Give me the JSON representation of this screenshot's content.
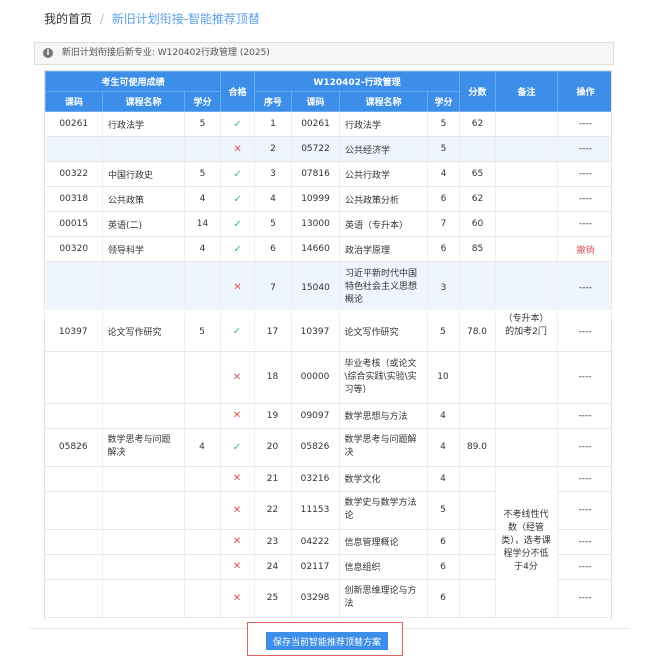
{
  "breadcrumb": {
    "home": "我的首页",
    "separator": "/",
    "current": "新旧计划衔接-智能推荐顶替"
  },
  "notice": {
    "text": "新旧计划衔接后新专业: W120402行政管理 (2025)"
  },
  "headers": {
    "group_left": "考生可使用成绩",
    "group_right": "W120402-行政管理",
    "pass": "合格",
    "score": "分数",
    "remark": "备注",
    "op": "操作",
    "left_code": "课码",
    "left_name": "课程名称",
    "left_credit": "学分",
    "seq": "序号",
    "right_code": "课码",
    "right_name": "课程名称",
    "right_credit": "学分"
  },
  "top_rows": [
    {
      "lcode": "00261",
      "lname": "行政法学",
      "lcredit": "5",
      "pass": "✓",
      "seq": "1",
      "rcode": "00261",
      "rname": "行政法学",
      "rcredit": "5",
      "score": "62",
      "op": "----"
    },
    {
      "lcode": "",
      "lname": "",
      "lcredit": "",
      "pass": "✕",
      "seq": "2",
      "rcode": "05722",
      "rname": "公共经济学",
      "rcredit": "5",
      "score": "",
      "op": "----"
    },
    {
      "lcode": "00322",
      "lname": "中国行政史",
      "lcredit": "5",
      "pass": "✓",
      "seq": "3",
      "rcode": "07816",
      "rname": "公共行政学",
      "rcredit": "4",
      "score": "65",
      "op": "----"
    },
    {
      "lcode": "00318",
      "lname": "公共政策",
      "lcredit": "4",
      "pass": "✓",
      "seq": "4",
      "rcode": "10999",
      "rname": "公共政策分析",
      "rcredit": "6",
      "score": "62",
      "op": "----"
    },
    {
      "lcode": "00015",
      "lname": "英语(二)",
      "lcredit": "14",
      "pass": "✓",
      "seq": "5",
      "rcode": "13000",
      "rname": "英语（专升本）",
      "rcredit": "7",
      "score": "60",
      "op": "----"
    },
    {
      "lcode": "00320",
      "lname": "领导科学",
      "lcredit": "4",
      "pass": "✓",
      "seq": "6",
      "rcode": "14660",
      "rname": "政治学原理",
      "rcredit": "6",
      "score": "85",
      "op": "撤销"
    },
    {
      "lcode": "",
      "lname": "",
      "lcredit": "",
      "pass": "✕",
      "seq": "7",
      "rcode": "15040",
      "rname": "习近平新时代中国特色社会主义思想概论",
      "rcredit": "3",
      "score": "",
      "op": "----"
    }
  ],
  "bottom_rows": [
    {
      "lcode": "10397",
      "lname": "论文写作研究",
      "lcredit": "5",
      "pass": "✓",
      "seq": "17",
      "rcode": "10397",
      "rname": "论文写作研究",
      "rcredit": "5",
      "score": "78.0",
      "op": "----"
    },
    {
      "lcode": "",
      "lname": "",
      "lcredit": "",
      "pass": "✕",
      "seq": "18",
      "rcode": "00000",
      "rname": "毕业考核（或论文\\综合实践\\实验\\实习等）",
      "rcredit": "10",
      "score": "",
      "op": "----"
    },
    {
      "lcode": "",
      "lname": "",
      "lcredit": "",
      "pass": "✕",
      "seq": "19",
      "rcode": "09097",
      "rname": "数学思想与方法",
      "rcredit": "4",
      "score": "",
      "op": "----"
    },
    {
      "lcode": "05826",
      "lname": "数学思考与问题解决",
      "lcredit": "4",
      "pass": "✓",
      "seq": "20",
      "rcode": "05826",
      "rname": "数学思考与问题解决",
      "rcredit": "4",
      "score": "89.0",
      "op": "----"
    },
    {
      "lcode": "",
      "lname": "",
      "lcredit": "",
      "pass": "✕",
      "seq": "21",
      "rcode": "03216",
      "rname": "数学文化",
      "rcredit": "4",
      "score": "",
      "op": "----"
    },
    {
      "lcode": "",
      "lname": "",
      "lcredit": "",
      "pass": "✕",
      "seq": "22",
      "rcode": "11153",
      "rname": "数学史与数学方法论",
      "rcredit": "5",
      "score": "",
      "op": "----"
    },
    {
      "lcode": "",
      "lname": "",
      "lcredit": "",
      "pass": "✕",
      "seq": "23",
      "rcode": "04222",
      "rname": "信息管理概论",
      "rcredit": "6",
      "score": "",
      "op": "----"
    },
    {
      "lcode": "",
      "lname": "",
      "lcredit": "",
      "pass": "✕",
      "seq": "24",
      "rcode": "02117",
      "rname": "信息组织",
      "rcredit": "6",
      "score": "",
      "op": "----"
    },
    {
      "lcode": "",
      "lname": "",
      "lcredit": "",
      "pass": "✕",
      "seq": "25",
      "rcode": "03298",
      "rname": "创新思维理论与方法",
      "rcredit": "6",
      "score": "",
      "op": "----"
    }
  ],
  "remarks": {
    "top_partial": "（专升本）的加考2门",
    "elective": "不考线性代数（经管类），选考课程学分不低于4分"
  },
  "save_button": "保存当前智能推荐顶替方案",
  "colors": {
    "header_blue": "#3d8ee8",
    "pass_green": "#3cb878",
    "fail_red": "#e05555",
    "row_highlight": "#eef5fd"
  }
}
